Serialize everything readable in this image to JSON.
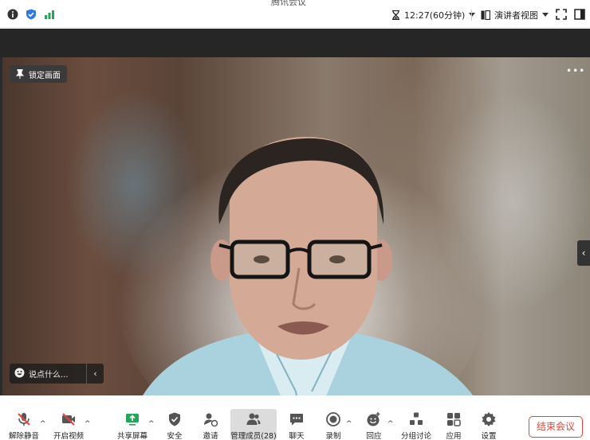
{
  "window": {
    "title_fragment": "腾讯会议"
  },
  "topbar": {
    "timer": "12:27(60分钟)",
    "view_label": "演讲者视图"
  },
  "stage": {
    "lock_label": "锁定画面",
    "more_label": "•••",
    "chat_placeholder": "说点什么...",
    "side_arrow": "‹"
  },
  "toolbar": {
    "mute": "解除静音",
    "video": "开启视频",
    "share": "共享屏幕",
    "security": "安全",
    "invite": "邀请",
    "members": "管理成员(28)",
    "chat": "聊天",
    "record": "录制",
    "reactions": "回应",
    "breakout": "分组讨论",
    "apps": "应用",
    "settings": "设置",
    "end": "结束会议"
  },
  "colors": {
    "accent_green": "#23a55a",
    "end_red": "#e0483f",
    "shield_blue": "#2a7be4"
  }
}
